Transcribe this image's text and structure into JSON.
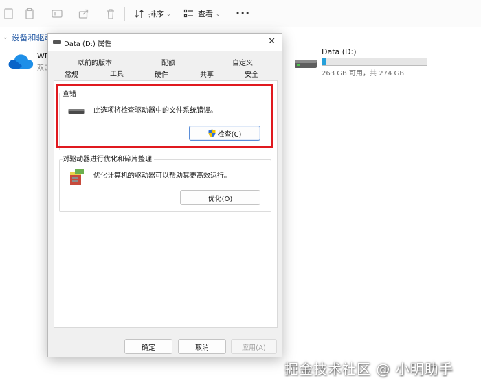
{
  "toolbar": {
    "sort_label": "排序",
    "view_label": "查看",
    "more_label": "···"
  },
  "explorer": {
    "section_title": "设备和驱动器",
    "onedrive": {
      "name": "WP",
      "sub": "双击"
    },
    "drive_d": {
      "name": "Data (D:)",
      "free_text": "263 GB 可用，共 274 GB",
      "used_fraction": 0.04,
      "bar_color": "#26a0da"
    }
  },
  "dialog": {
    "title": "Data (D:) 属性",
    "close_label": "✕",
    "tabs_row1": [
      "以前的版本",
      "配额",
      "自定义"
    ],
    "tabs_row2": [
      "常规",
      "工具",
      "硬件",
      "共享",
      "安全"
    ],
    "check_group": {
      "title": "查错",
      "description": "此选项将检查驱动器中的文件系统错误。",
      "button_label": "检查(C)"
    },
    "optimize_group": {
      "title": "对驱动器进行优化和碎片整理",
      "description": "优化计算机的驱动器可以帮助其更高效运行。",
      "button_label": "优化(O)"
    },
    "footer": {
      "ok_label": "确定",
      "cancel_label": "取消",
      "apply_label": "应用(A)"
    }
  },
  "annotation": {
    "highlight_color": "#e0191f"
  },
  "watermark": "掘金技术社区 @ 小明助手"
}
